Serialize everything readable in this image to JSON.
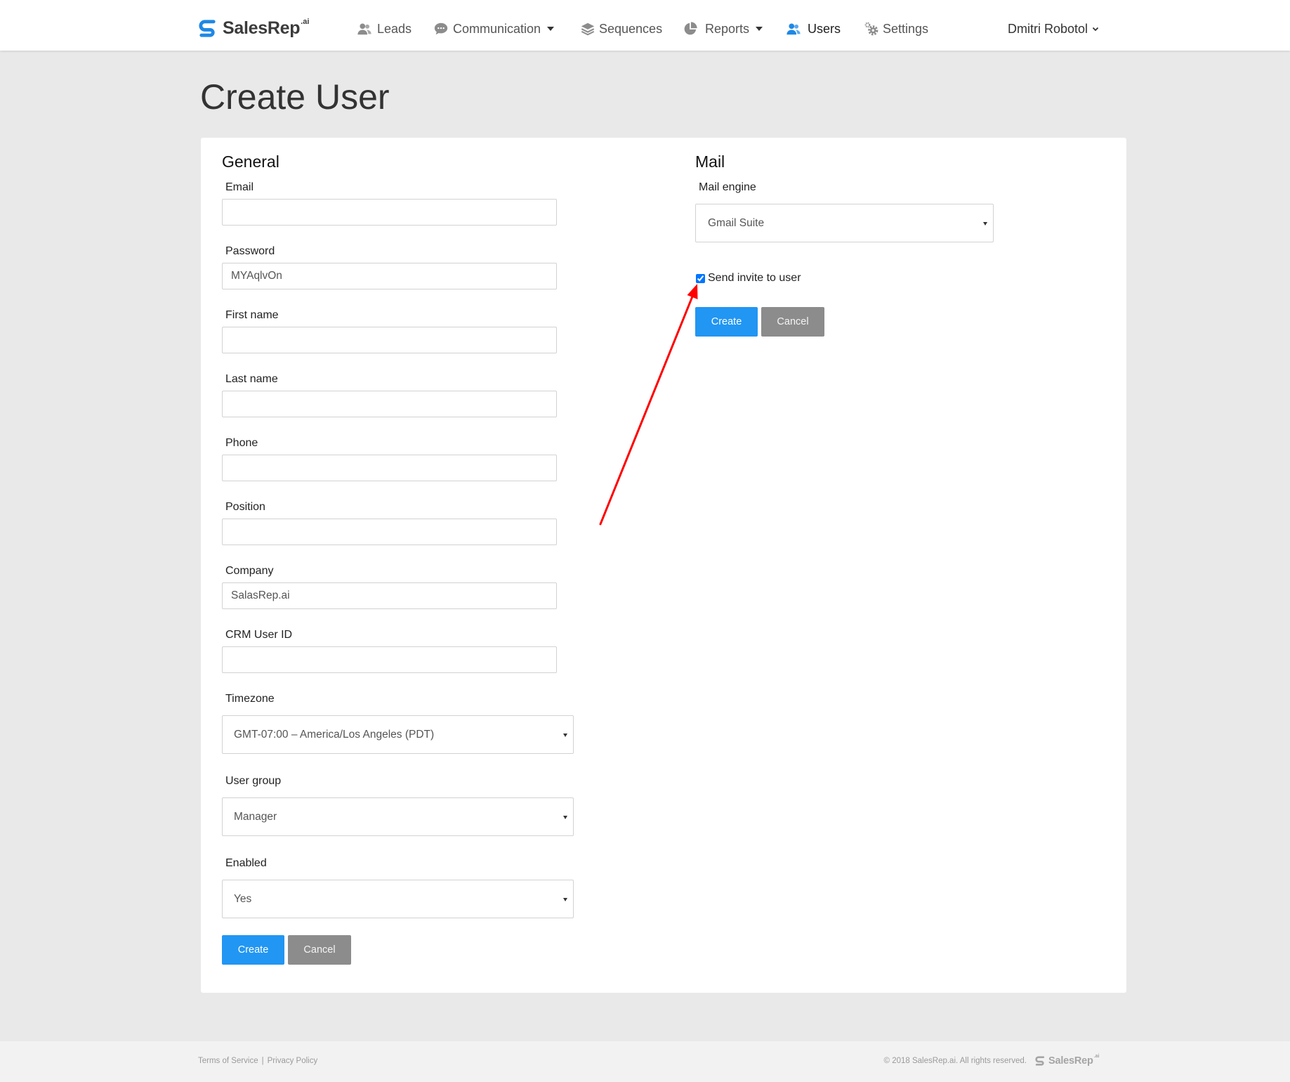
{
  "app": {
    "brand": "SalesRep",
    "brand_suffix": ".ai"
  },
  "nav": {
    "items": [
      {
        "label": "Leads",
        "icon": "leads-icon",
        "active": false,
        "dropdown": false
      },
      {
        "label": "Communication",
        "icon": "communication-icon",
        "active": false,
        "dropdown": true
      },
      {
        "label": "Sequences",
        "icon": "sequences-icon",
        "active": false,
        "dropdown": false
      },
      {
        "label": "Reports",
        "icon": "reports-icon",
        "active": false,
        "dropdown": true
      },
      {
        "label": "Users",
        "icon": "users-icon",
        "active": true,
        "dropdown": false
      },
      {
        "label": "Settings",
        "icon": "settings-icon",
        "active": false,
        "dropdown": false
      }
    ],
    "user_menu": {
      "name": "Dmitri Robotol",
      "icon": "chevron-down-icon"
    }
  },
  "page": {
    "title": "Create User"
  },
  "general": {
    "heading": "General",
    "email": {
      "label": "Email",
      "value": ""
    },
    "password": {
      "label": "Password",
      "value": "MYAqlvOn"
    },
    "first_name": {
      "label": "First name",
      "value": ""
    },
    "last_name": {
      "label": "Last name",
      "value": ""
    },
    "phone": {
      "label": "Phone",
      "value": ""
    },
    "position": {
      "label": "Position",
      "value": ""
    },
    "company": {
      "label": "Company",
      "value": "SalasRep.ai"
    },
    "crm_user_id": {
      "label": "CRM User ID",
      "value": ""
    },
    "timezone": {
      "label": "Timezone",
      "selected": "GMT-07:00 – America/Los Angeles (PDT)"
    },
    "user_group": {
      "label": "User group",
      "selected": "Manager"
    },
    "enabled": {
      "label": "Enabled",
      "selected": "Yes"
    },
    "create_label": "Create",
    "cancel_label": "Cancel"
  },
  "mail": {
    "heading": "Mail",
    "mail_engine": {
      "label": "Mail engine",
      "selected": "Gmail Suite"
    },
    "send_invite": {
      "label": "Send invite to user",
      "checked": true
    },
    "create_label": "Create",
    "cancel_label": "Cancel"
  },
  "footer": {
    "terms": "Terms of Service",
    "separator": "|",
    "privacy": "Privacy Policy",
    "copyright": "© 2018 SalesRep.ai. All rights reserved.",
    "brand": "SalesRep",
    "brand_suffix": ".ai"
  },
  "colors": {
    "brand": "#1e88e5",
    "primary_button": "#2196f3",
    "secondary_button": "#8c8c8c",
    "annotation_arrow": "#ff0000"
  }
}
